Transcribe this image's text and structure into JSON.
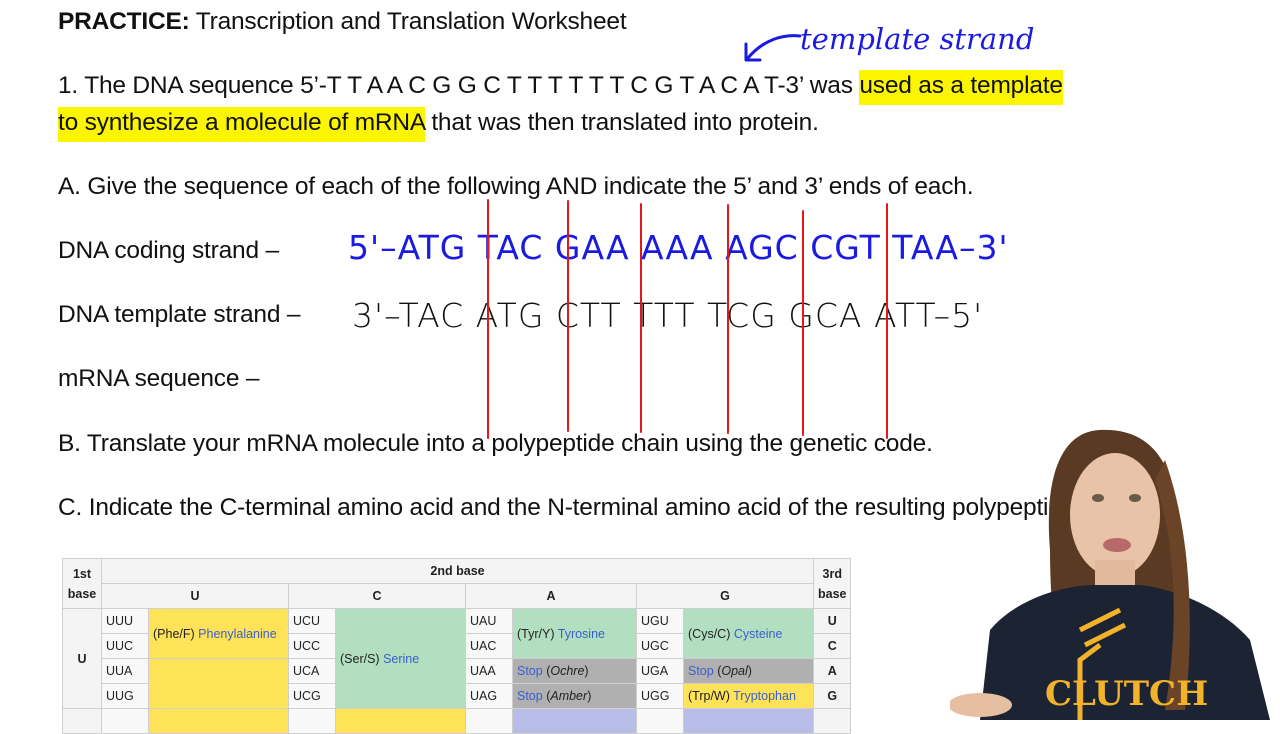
{
  "header": {
    "title_bold": "PRACTICE:",
    "title_rest": " Transcription and Translation Worksheet"
  },
  "annotation": {
    "label": "template strand",
    "arrow_icon": "arrow-down-left-icon"
  },
  "question1": {
    "line1_text": "1. The DNA sequence 5’-T T A A C G G C T T T T T T C G T A C A T-3’ was ",
    "line1_highlight": "used as a template",
    "line2_highlight": "to synthesize a molecule of mRNA",
    "line2_text": " that was then translated into protein.",
    "highlight_color": "#fbf600"
  },
  "partA": {
    "prompt": "A. Give the sequence of each of the following AND indicate the 5’ and 3’ ends of each.",
    "coding_label": "DNA coding strand –",
    "template_label": "DNA template strand –",
    "mrna_label": "mRNA sequence –",
    "coding_answer": "5'–ATG TAC GAA AAA AGC CGT TAA–3'",
    "template_answer": "3'–TAC ATG CTT TTT TCG GCA ATT–5'",
    "coding_color": "#1a1ae0",
    "divider_color": "#e5171a"
  },
  "partB": {
    "prompt": "B. Translate your mRNA molecule into a polypeptide chain using the genetic code."
  },
  "partC": {
    "prompt": "C. Indicate the C-terminal amino acid and the N-terminal amino acid of the resulting polypeptide."
  },
  "codon_table": {
    "first_base_label": "1st base",
    "second_base_label": "2nd base",
    "third_base_label": "3rd base",
    "second_bases": [
      "U",
      "C",
      "A",
      "G"
    ],
    "row_U": {
      "first": "U",
      "codons_U": [
        "UUU",
        "UUC",
        "UUA",
        "UUG"
      ],
      "codons_C": [
        "UCU",
        "UCC",
        "UCA",
        "UCG"
      ],
      "codons_A": [
        "UAU",
        "UAC",
        "UAA",
        "UAG"
      ],
      "codons_G": [
        "UGU",
        "UGC",
        "UGA",
        "UGG"
      ],
      "third": [
        "U",
        "C",
        "A",
        "G"
      ],
      "phe_abbr": "(Phe/F) ",
      "phe_name": "Phenylalanine",
      "ser_abbr": "(Ser/S) ",
      "ser_name": "Serine",
      "tyr_abbr": "(Tyr/Y) ",
      "tyr_name": "Tyrosine",
      "cys_abbr": "(Cys/C) ",
      "cys_name": "Cysteine",
      "stop1_name": "Stop",
      "stop1_type": "Ochre",
      "stop2_name": "Stop",
      "stop2_type": "Amber",
      "stop3_name": "Stop",
      "stop3_type": "Opal",
      "trp_abbr": "(Trp/W) ",
      "trp_name": "Tryptophan"
    }
  },
  "presenter": {
    "shirt_text": "CLUTCH"
  }
}
